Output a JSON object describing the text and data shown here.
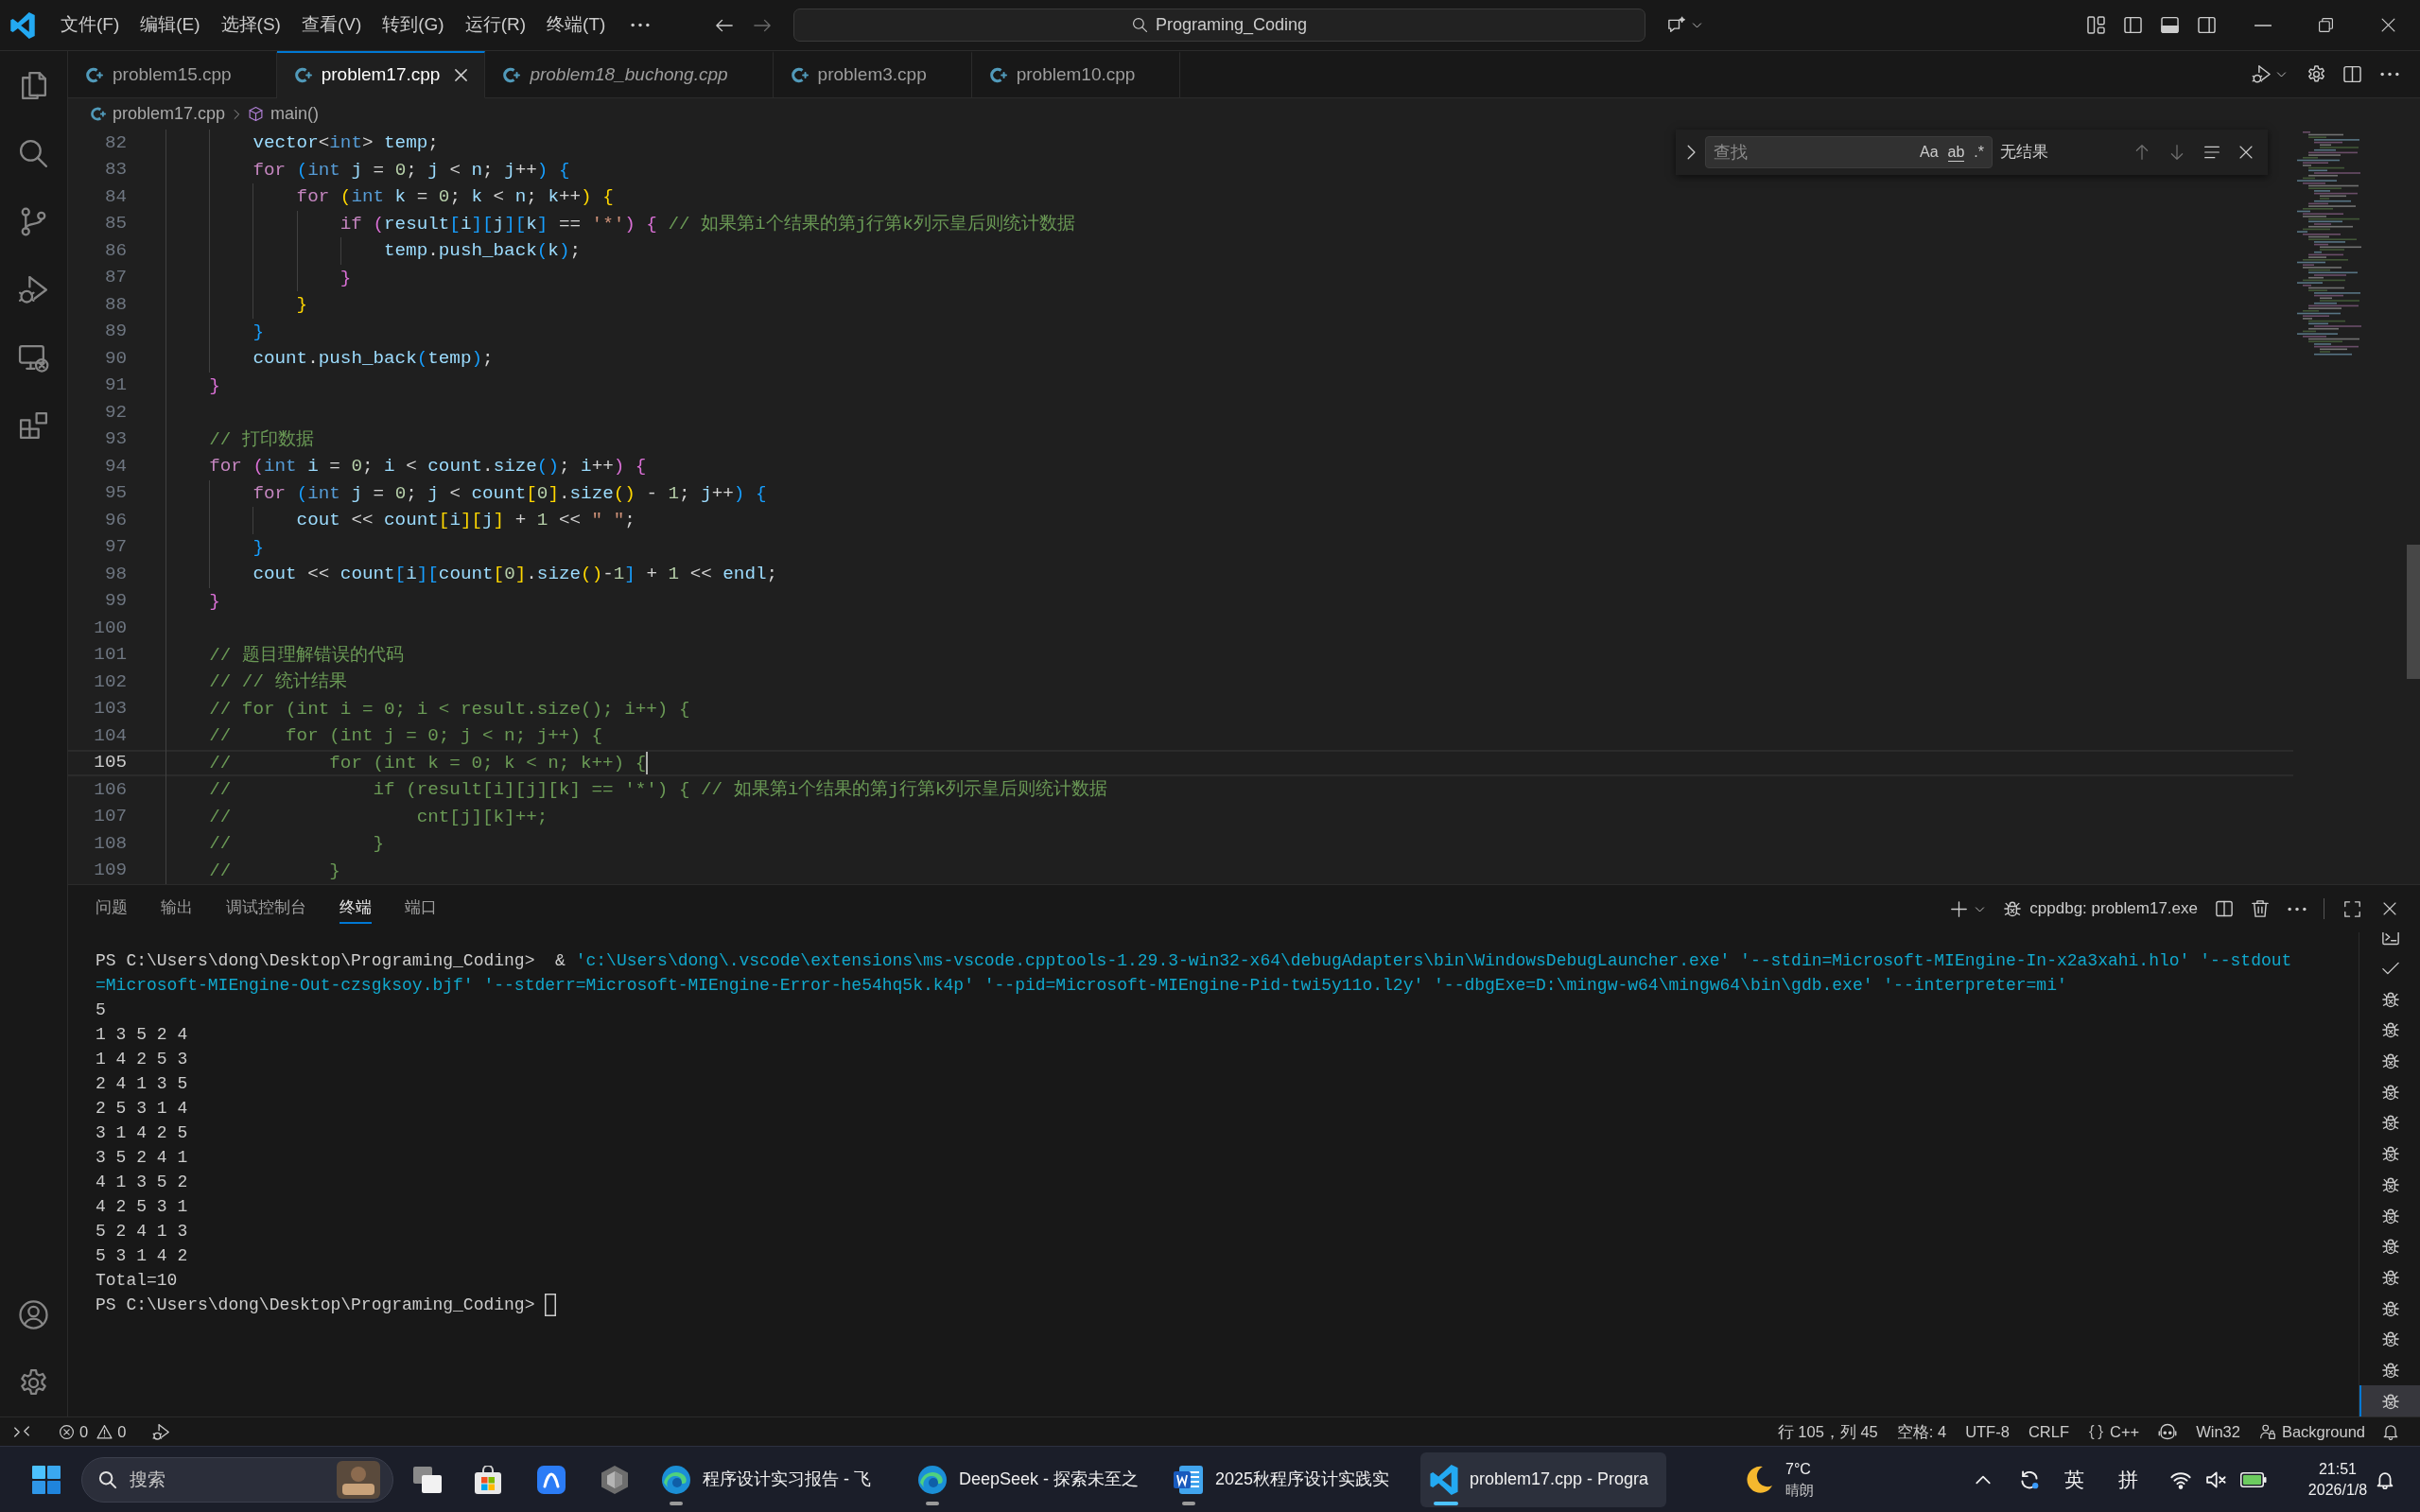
{
  "title_bar": {
    "menu": [
      "文件(F)",
      "编辑(E)",
      "选择(S)",
      "查看(V)",
      "转到(G)",
      "运行(R)",
      "终端(T)"
    ],
    "command_center": "Programing_Coding"
  },
  "editor_tabs": [
    {
      "label": "problem15.cpp",
      "selected": false,
      "preview": false
    },
    {
      "label": "problem17.cpp",
      "selected": true,
      "preview": false
    },
    {
      "label": "problem18_buchong.cpp",
      "selected": false,
      "preview": true
    },
    {
      "label": "problem3.cpp",
      "selected": false,
      "preview": false
    },
    {
      "label": "problem10.cpp",
      "selected": false,
      "preview": false
    }
  ],
  "breadcrumb": [
    {
      "kind": "file",
      "label": "problem17.cpp"
    },
    {
      "kind": "function",
      "label": "main()"
    }
  ],
  "find_widget": {
    "placeholder": "查找",
    "options": [
      {
        "kind": "case",
        "label": "Aa"
      },
      {
        "kind": "word",
        "label": "ab"
      },
      {
        "kind": "regex",
        "label": ".*"
      }
    ],
    "result": "无结果"
  },
  "editor": {
    "lines": [
      {
        "number": "82",
        "current": false,
        "tokens": [
          {
            "kind": "id",
            "text": "        vector"
          },
          {
            "kind": "op",
            "text": "<"
          },
          {
            "kind": "type",
            "text": "int"
          },
          {
            "kind": "op",
            "text": "> "
          },
          {
            "kind": "id",
            "text": "temp"
          },
          {
            "kind": "op",
            "text": ";"
          }
        ]
      },
      {
        "number": "83",
        "current": false,
        "tokens": [
          {
            "kind": "kw",
            "text": "        for "
          },
          {
            "kind": "b3",
            "text": "("
          },
          {
            "kind": "type",
            "text": "int "
          },
          {
            "kind": "id",
            "text": "j"
          },
          {
            "kind": "op",
            "text": " = "
          },
          {
            "kind": "num",
            "text": "0"
          },
          {
            "kind": "op",
            "text": "; "
          },
          {
            "kind": "id",
            "text": "j"
          },
          {
            "kind": "op",
            "text": " < "
          },
          {
            "kind": "id",
            "text": "n"
          },
          {
            "kind": "op",
            "text": "; "
          },
          {
            "kind": "id",
            "text": "j"
          },
          {
            "kind": "op",
            "text": "++"
          },
          {
            "kind": "b3",
            "text": ") {"
          }
        ]
      },
      {
        "number": "84",
        "current": false,
        "tokens": [
          {
            "kind": "kw",
            "text": "            for "
          },
          {
            "kind": "b1",
            "text": "("
          },
          {
            "kind": "type",
            "text": "int "
          },
          {
            "kind": "id",
            "text": "k"
          },
          {
            "kind": "op",
            "text": " = "
          },
          {
            "kind": "num",
            "text": "0"
          },
          {
            "kind": "op",
            "text": "; "
          },
          {
            "kind": "id",
            "text": "k"
          },
          {
            "kind": "op",
            "text": " < "
          },
          {
            "kind": "id",
            "text": "n"
          },
          {
            "kind": "op",
            "text": "; "
          },
          {
            "kind": "id",
            "text": "k"
          },
          {
            "kind": "op",
            "text": "++"
          },
          {
            "kind": "b1",
            "text": ") {"
          }
        ]
      },
      {
        "number": "85",
        "current": false,
        "tokens": [
          {
            "kind": "kw",
            "text": "                if "
          },
          {
            "kind": "b2",
            "text": "("
          },
          {
            "kind": "id",
            "text": "result"
          },
          {
            "kind": "b3",
            "text": "["
          },
          {
            "kind": "id",
            "text": "i"
          },
          {
            "kind": "b3",
            "text": "]["
          },
          {
            "kind": "id",
            "text": "j"
          },
          {
            "kind": "b3",
            "text": "]["
          },
          {
            "kind": "id",
            "text": "k"
          },
          {
            "kind": "b3",
            "text": "]"
          },
          {
            "kind": "op",
            "text": " == "
          },
          {
            "kind": "str",
            "text": "'*'"
          },
          {
            "kind": "b2",
            "text": ") { "
          },
          {
            "kind": "com",
            "text": "// 如果第i个结果的第j行第k列示皇后则统计数据"
          }
        ]
      },
      {
        "number": "86",
        "current": false,
        "tokens": [
          {
            "kind": "id",
            "text": "                    temp"
          },
          {
            "kind": "op",
            "text": "."
          },
          {
            "kind": "id",
            "text": "push_back"
          },
          {
            "kind": "b3",
            "text": "("
          },
          {
            "kind": "id",
            "text": "k"
          },
          {
            "kind": "b3",
            "text": ")"
          },
          {
            "kind": "op",
            "text": ";"
          }
        ]
      },
      {
        "number": "87",
        "current": false,
        "tokens": [
          {
            "kind": "b2",
            "text": "                }"
          }
        ]
      },
      {
        "number": "88",
        "current": false,
        "tokens": [
          {
            "kind": "b1",
            "text": "            }"
          }
        ]
      },
      {
        "number": "89",
        "current": false,
        "tokens": [
          {
            "kind": "b3",
            "text": "        }"
          }
        ]
      },
      {
        "number": "90",
        "current": false,
        "tokens": [
          {
            "kind": "id",
            "text": "        count"
          },
          {
            "kind": "op",
            "text": "."
          },
          {
            "kind": "id",
            "text": "push_back"
          },
          {
            "kind": "b3",
            "text": "("
          },
          {
            "kind": "id",
            "text": "temp"
          },
          {
            "kind": "b3",
            "text": ")"
          },
          {
            "kind": "op",
            "text": ";"
          }
        ]
      },
      {
        "number": "91",
        "current": false,
        "tokens": [
          {
            "kind": "b2",
            "text": "    }"
          }
        ]
      },
      {
        "number": "92",
        "current": false
      },
      {
        "number": "93",
        "current": false,
        "tokens": [
          {
            "kind": "com",
            "text": "    // 打印数据"
          }
        ]
      },
      {
        "number": "94",
        "current": false,
        "tokens": [
          {
            "kind": "kw",
            "text": "    for "
          },
          {
            "kind": "b2",
            "text": "("
          },
          {
            "kind": "type",
            "text": "int "
          },
          {
            "kind": "id",
            "text": "i"
          },
          {
            "kind": "op",
            "text": " = "
          },
          {
            "kind": "num",
            "text": "0"
          },
          {
            "kind": "op",
            "text": "; "
          },
          {
            "kind": "id",
            "text": "i"
          },
          {
            "kind": "op",
            "text": " < "
          },
          {
            "kind": "id",
            "text": "count"
          },
          {
            "kind": "op",
            "text": "."
          },
          {
            "kind": "id",
            "text": "size"
          },
          {
            "kind": "b3",
            "text": "()"
          },
          {
            "kind": "op",
            "text": "; "
          },
          {
            "kind": "id",
            "text": "i"
          },
          {
            "kind": "op",
            "text": "++"
          },
          {
            "kind": "b2",
            "text": ") {"
          }
        ]
      },
      {
        "number": "95",
        "current": false,
        "tokens": [
          {
            "kind": "kw",
            "text": "        for "
          },
          {
            "kind": "b3",
            "text": "("
          },
          {
            "kind": "type",
            "text": "int "
          },
          {
            "kind": "id",
            "text": "j"
          },
          {
            "kind": "op",
            "text": " = "
          },
          {
            "kind": "num",
            "text": "0"
          },
          {
            "kind": "op",
            "text": "; "
          },
          {
            "kind": "id",
            "text": "j"
          },
          {
            "kind": "op",
            "text": " < "
          },
          {
            "kind": "id",
            "text": "count"
          },
          {
            "kind": "b1",
            "text": "["
          },
          {
            "kind": "num",
            "text": "0"
          },
          {
            "kind": "b1",
            "text": "]"
          },
          {
            "kind": "op",
            "text": "."
          },
          {
            "kind": "id",
            "text": "size"
          },
          {
            "kind": "b1",
            "text": "()"
          },
          {
            "kind": "op",
            "text": " - "
          },
          {
            "kind": "num",
            "text": "1"
          },
          {
            "kind": "op",
            "text": "; "
          },
          {
            "kind": "id",
            "text": "j"
          },
          {
            "kind": "op",
            "text": "++"
          },
          {
            "kind": "b3",
            "text": ") {"
          }
        ]
      },
      {
        "number": "96",
        "current": false,
        "tokens": [
          {
            "kind": "id",
            "text": "            cout"
          },
          {
            "kind": "op",
            "text": " << "
          },
          {
            "kind": "id",
            "text": "count"
          },
          {
            "kind": "b1",
            "text": "["
          },
          {
            "kind": "id",
            "text": "i"
          },
          {
            "kind": "b1",
            "text": "]["
          },
          {
            "kind": "id",
            "text": "j"
          },
          {
            "kind": "b1",
            "text": "]"
          },
          {
            "kind": "op",
            "text": " + "
          },
          {
            "kind": "num",
            "text": "1"
          },
          {
            "kind": "op",
            "text": " << "
          },
          {
            "kind": "str",
            "text": "\" \""
          },
          {
            "kind": "op",
            "text": ";"
          }
        ]
      },
      {
        "number": "97",
        "current": false,
        "tokens": [
          {
            "kind": "b3",
            "text": "        }"
          }
        ]
      },
      {
        "number": "98",
        "current": false,
        "tokens": [
          {
            "kind": "id",
            "text": "        cout"
          },
          {
            "kind": "op",
            "text": " << "
          },
          {
            "kind": "id",
            "text": "count"
          },
          {
            "kind": "b3",
            "text": "["
          },
          {
            "kind": "id",
            "text": "i"
          },
          {
            "kind": "b3",
            "text": "]["
          },
          {
            "kind": "id",
            "text": "count"
          },
          {
            "kind": "b1",
            "text": "["
          },
          {
            "kind": "num",
            "text": "0"
          },
          {
            "kind": "b1",
            "text": "]"
          },
          {
            "kind": "op",
            "text": "."
          },
          {
            "kind": "id",
            "text": "size"
          },
          {
            "kind": "b1",
            "text": "()"
          },
          {
            "kind": "op",
            "text": "-"
          },
          {
            "kind": "num",
            "text": "1"
          },
          {
            "kind": "b3",
            "text": "]"
          },
          {
            "kind": "op",
            "text": " + "
          },
          {
            "kind": "num",
            "text": "1"
          },
          {
            "kind": "op",
            "text": " << "
          },
          {
            "kind": "id",
            "text": "endl"
          },
          {
            "kind": "op",
            "text": ";"
          }
        ]
      },
      {
        "number": "99",
        "current": false,
        "tokens": [
          {
            "kind": "b2",
            "text": "    }"
          }
        ]
      },
      {
        "number": "100",
        "current": false
      },
      {
        "number": "101",
        "current": false,
        "tokens": [
          {
            "kind": "com",
            "text": "    // 题目理解错误的代码"
          }
        ]
      },
      {
        "number": "102",
        "current": false,
        "tokens": [
          {
            "kind": "com",
            "text": "    // // 统计结果"
          }
        ]
      },
      {
        "number": "103",
        "current": false,
        "tokens": [
          {
            "kind": "com",
            "text": "    // for (int i = 0; i < result.size(); i++) {"
          }
        ]
      },
      {
        "number": "104",
        "current": false,
        "tokens": [
          {
            "kind": "com",
            "text": "    //     for (int j = 0; j < n; j++) {"
          }
        ]
      },
      {
        "number": "105",
        "current": true,
        "tokens": [
          {
            "kind": "com",
            "text": "    //         for (int k = 0; k < n; k++) {"
          }
        ]
      },
      {
        "number": "106",
        "current": false,
        "tokens": [
          {
            "kind": "com",
            "text": "    //             if (result[i][j][k] == '*') { // 如果第i个结果的第j行第k列示皇后则统计数据"
          }
        ]
      },
      {
        "number": "107",
        "current": false,
        "tokens": [
          {
            "kind": "com",
            "text": "    //                 cnt[j][k]++;"
          }
        ]
      },
      {
        "number": "108",
        "current": false,
        "tokens": [
          {
            "kind": "com",
            "text": "    //             }"
          }
        ]
      },
      {
        "number": "109",
        "current": false,
        "tokens": [
          {
            "kind": "com",
            "text": "    //         }"
          }
        ]
      }
    ]
  },
  "panel": {
    "tabs": [
      {
        "label": "问题",
        "selected": false
      },
      {
        "label": "输出",
        "selected": false
      },
      {
        "label": "调试控制台",
        "selected": false
      },
      {
        "label": "终端",
        "selected": true
      },
      {
        "label": "端口",
        "selected": false
      }
    ],
    "terminal_title": "cppdbg: problem17.exe",
    "terminal_lines": [
      {
        "parts": [
          {
            "kind": "plain",
            "text": "PS C:\\Users\\dong\\Desktop\\Programing_Coding>  & "
          },
          {
            "kind": "arg",
            "text": "'c:\\Users\\dong\\.vscode\\extensions\\ms-vscode.cpptools-1.29.3-win32-x64\\debugAdapters\\bin\\WindowsDebugLauncher.exe' '--stdin=Microsoft-MIEngine-In-x2a3xahi.hlo' '--stdout"
          }
        ]
      },
      {
        "parts": [
          {
            "kind": "arg",
            "text": "=Microsoft-MIEngine-Out-czsgksoy.bjf' '--stderr=Microsoft-MIEngine-Error-he54hq5k.k4p' '--pid=Microsoft-MIEngine-Pid-twi5y11o.l2y' '--dbgExe=D:\\mingw-w64\\mingw64\\bin\\gdb.exe' '--interpreter=mi'"
          }
        ]
      },
      {
        "parts": [
          {
            "kind": "plain",
            "text": "5"
          }
        ]
      },
      {
        "parts": [
          {
            "kind": "plain",
            "text": "1 3 5 2 4"
          }
        ]
      },
      {
        "parts": [
          {
            "kind": "plain",
            "text": "1 4 2 5 3"
          }
        ]
      },
      {
        "parts": [
          {
            "kind": "plain",
            "text": "2 4 1 3 5"
          }
        ]
      },
      {
        "parts": [
          {
            "kind": "plain",
            "text": "2 5 3 1 4"
          }
        ]
      },
      {
        "parts": [
          {
            "kind": "plain",
            "text": "3 1 4 2 5"
          }
        ]
      },
      {
        "parts": [
          {
            "kind": "plain",
            "text": "3 5 2 4 1"
          }
        ]
      },
      {
        "parts": [
          {
            "kind": "plain",
            "text": "4 1 3 5 2"
          }
        ]
      },
      {
        "parts": [
          {
            "kind": "plain",
            "text": "4 2 5 3 1"
          }
        ]
      },
      {
        "parts": [
          {
            "kind": "plain",
            "text": "5 2 4 1 3"
          }
        ]
      },
      {
        "parts": [
          {
            "kind": "plain",
            "text": "5 3 1 4 2"
          }
        ]
      },
      {
        "parts": [
          {
            "kind": "plain",
            "text": "Total=10"
          }
        ]
      },
      {
        "parts": [
          {
            "kind": "plain",
            "text": "PS C:\\Users\\dong\\Desktop\\Programing_Coding>"
          }
        ]
      }
    ],
    "terminal_list": [
      {
        "kind": "terminal",
        "selected": false
      },
      {
        "kind": "task",
        "selected": false
      },
      {
        "kind": "debug",
        "selected": false
      },
      {
        "kind": "debug",
        "selected": false
      },
      {
        "kind": "debug",
        "selected": false
      },
      {
        "kind": "debug",
        "selected": false
      },
      {
        "kind": "debug",
        "selected": false
      },
      {
        "kind": "debug",
        "selected": false
      },
      {
        "kind": "debug",
        "selected": false
      },
      {
        "kind": "debug",
        "selected": false
      },
      {
        "kind": "debug",
        "selected": false
      },
      {
        "kind": "debug",
        "selected": false
      },
      {
        "kind": "debug",
        "selected": false
      },
      {
        "kind": "debug",
        "selected": false
      },
      {
        "kind": "debug",
        "selected": false
      },
      {
        "kind": "debug",
        "selected": true
      }
    ]
  },
  "status_bar": {
    "errors": "0",
    "warnings": "0",
    "position": "行 105，列 45",
    "indentation": "空格: 4",
    "encoding": "UTF-8",
    "line_ending": "CRLF",
    "language": "C++",
    "platform": "Win32",
    "background": "Background"
  },
  "taskbar": {
    "search": {
      "placeholder": "搜索"
    },
    "windows": [
      {
        "kind": "browser",
        "title": "程序设计实习报告 - 飞",
        "selected": false
      },
      {
        "kind": "browser",
        "title": "DeepSeek - 探索未至之",
        "selected": false
      },
      {
        "kind": "document",
        "title": "2025秋程序设计实践实",
        "selected": false
      },
      {
        "kind": "editor",
        "title": "problem17.cpp - Progra",
        "selected": true
      }
    ],
    "weather": {
      "temperature": "7°C",
      "condition": "晴朗"
    },
    "input_indicators": [
      "英",
      "拼"
    ],
    "time": "21:51",
    "date": "2026/1/8"
  }
}
